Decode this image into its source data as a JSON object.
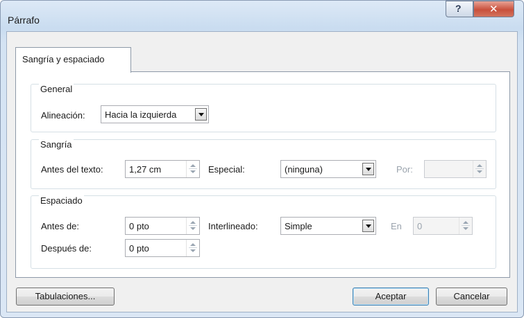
{
  "window": {
    "title": "Párrafo",
    "help_glyph": "?",
    "close_glyph": "✕"
  },
  "tab": {
    "label": "Sangría y espaciado"
  },
  "general": {
    "title": "General",
    "alignment_label": "Alineación:",
    "alignment_value": "Hacia la izquierda"
  },
  "indent": {
    "title": "Sangría",
    "before_text_label": "Antes del texto:",
    "before_text_value": "1,27 cm",
    "special_label": "Especial:",
    "special_value": "(ninguna)",
    "by_label": "Por:",
    "by_value": ""
  },
  "spacing": {
    "title": "Espaciado",
    "before_label": "Antes de:",
    "before_value": "0 pto",
    "after_label": "Después de:",
    "after_value": "0 pto",
    "line_spacing_label": "Interlineado:",
    "line_spacing_value": "Simple",
    "at_label": "En",
    "at_value": "0"
  },
  "buttons": {
    "tabs": "Tabulaciones...",
    "ok": "Aceptar",
    "cancel": "Cancelar"
  }
}
